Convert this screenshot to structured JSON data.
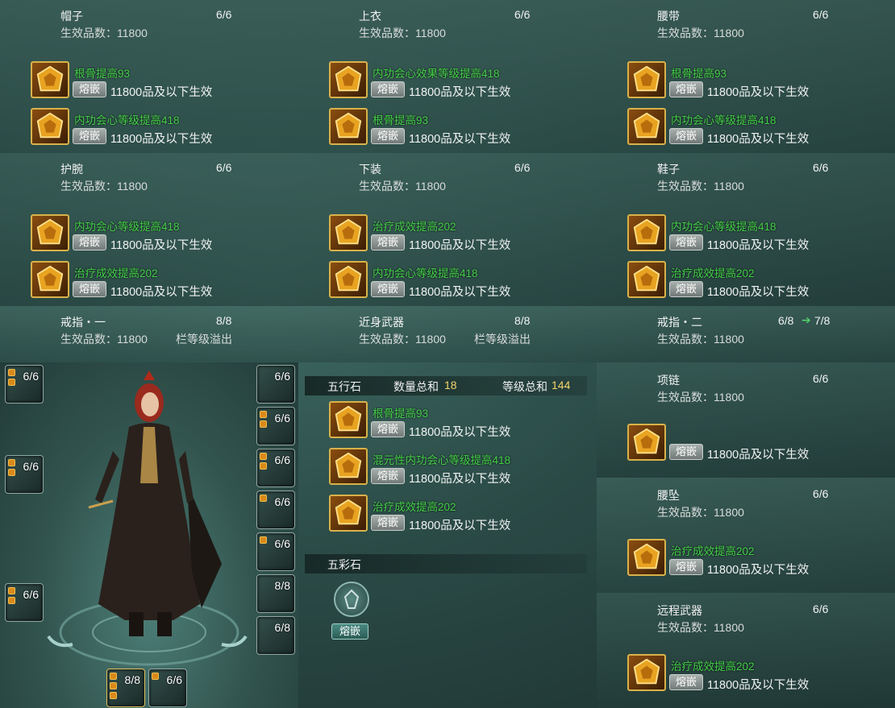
{
  "equipment": [
    {
      "name": "帽子",
      "count": "6/6",
      "grade_label": "生效品数：11800",
      "overflow": "",
      "gems": [
        {
          "name": "根骨提高93",
          "inlay": "熔嵌",
          "effect": "11800品及以下生效"
        },
        {
          "name": "内功会心等级提高418",
          "inlay": "熔嵌",
          "effect": "11800品及以下生效"
        }
      ]
    },
    {
      "name": "上衣",
      "count": "6/6",
      "grade_label": "生效品数：11800",
      "overflow": "",
      "gems": [
        {
          "name": "内功会心效果等级提高418",
          "inlay": "熔嵌",
          "effect": "11800品及以下生效"
        },
        {
          "name": "根骨提高93",
          "inlay": "熔嵌",
          "effect": "11800品及以下生效"
        }
      ]
    },
    {
      "name": "腰带",
      "count": "6/6",
      "grade_label": "生效品数：11800",
      "overflow": "",
      "gems": [
        {
          "name": "根骨提高93",
          "inlay": "熔嵌",
          "effect": "11800品及以下生效"
        },
        {
          "name": "内功会心等级提高418",
          "inlay": "熔嵌",
          "effect": "11800品及以下生效"
        }
      ]
    },
    {
      "name": "护腕",
      "count": "6/6",
      "grade_label": "生效品数：11800",
      "overflow": "",
      "gems": [
        {
          "name": "内功会心等级提高418",
          "inlay": "熔嵌",
          "effect": "11800品及以下生效"
        },
        {
          "name": "治疗成效提高202",
          "inlay": "熔嵌",
          "effect": "11800品及以下生效"
        }
      ]
    },
    {
      "name": "下装",
      "count": "6/6",
      "grade_label": "生效品数：11800",
      "overflow": "",
      "gems": [
        {
          "name": "治疗成效提高202",
          "inlay": "熔嵌",
          "effect": "11800品及以下生效"
        },
        {
          "name": "内功会心等级提高418",
          "inlay": "熔嵌",
          "effect": "11800品及以下生效"
        }
      ]
    },
    {
      "name": "鞋子",
      "count": "6/6",
      "grade_label": "生效品数：11800",
      "overflow": "",
      "gems": [
        {
          "name": "内功会心等级提高418",
          "inlay": "熔嵌",
          "effect": "11800品及以下生效"
        },
        {
          "name": "治疗成效提高202",
          "inlay": "熔嵌",
          "effect": "11800品及以下生效"
        }
      ]
    },
    {
      "name": "戒指・一",
      "count": "8/8",
      "grade_label": "生效品数：11800",
      "overflow": "栏等级溢出",
      "gems": []
    },
    {
      "name": "近身武器",
      "count": "8/8",
      "grade_label": "生效品数：11800",
      "overflow": "栏等级溢出",
      "gems": []
    },
    {
      "name": "戒指・二",
      "count": "6/8",
      "count_next": "7/8",
      "grade_label": "生效品数：11800",
      "overflow": "",
      "gems": []
    },
    {
      "name": "项链",
      "count": "6/6",
      "grade_label": "生效品数：11800",
      "overflow": "",
      "gems": [
        {
          "name": "",
          "inlay": "熔嵌",
          "effect": "11800品及以下生效"
        }
      ]
    },
    {
      "name": "腰坠",
      "count": "6/6",
      "grade_label": "生效品数：11800",
      "overflow": "",
      "gems": [
        {
          "name": "治疗成效提高202",
          "inlay": "熔嵌",
          "effect": "11800品及以下生效"
        }
      ]
    },
    {
      "name": "远程武器",
      "count": "6/6",
      "grade_label": "生效品数：11800",
      "overflow": "",
      "gems": [
        {
          "name": "治疗成效提高202",
          "inlay": "熔嵌",
          "effect": "11800品及以下生效"
        }
      ]
    }
  ],
  "wuxing": {
    "title": "五行石",
    "qty_label": "数量总和",
    "qty_value": "18",
    "level_label": "等级总和",
    "level_value": "144",
    "gems": [
      {
        "name": "根骨提高93",
        "inlay": "熔嵌",
        "effect": "11800品及以下生效"
      },
      {
        "name": "混元性内功会心等级提高418",
        "inlay": "熔嵌",
        "effect": "11800品及以下生效"
      },
      {
        "name": "治疗成效提高202",
        "inlay": "熔嵌",
        "effect": "11800品及以下生效"
      }
    ]
  },
  "wucai": {
    "title": "五彩石",
    "inlay": "熔嵌"
  },
  "slots_left": [
    "6/6",
    "6/6",
    "6/6"
  ],
  "slots_right": [
    "6/6",
    "6/6",
    "6/6",
    "6/6",
    "6/6",
    "8/8",
    "6/8"
  ],
  "slots_bottom": [
    "8/8",
    "6/6"
  ],
  "colors": {
    "gem_name": "#45d14a",
    "highlight": "#f2d46a",
    "gem_border": "#d8b24a"
  }
}
